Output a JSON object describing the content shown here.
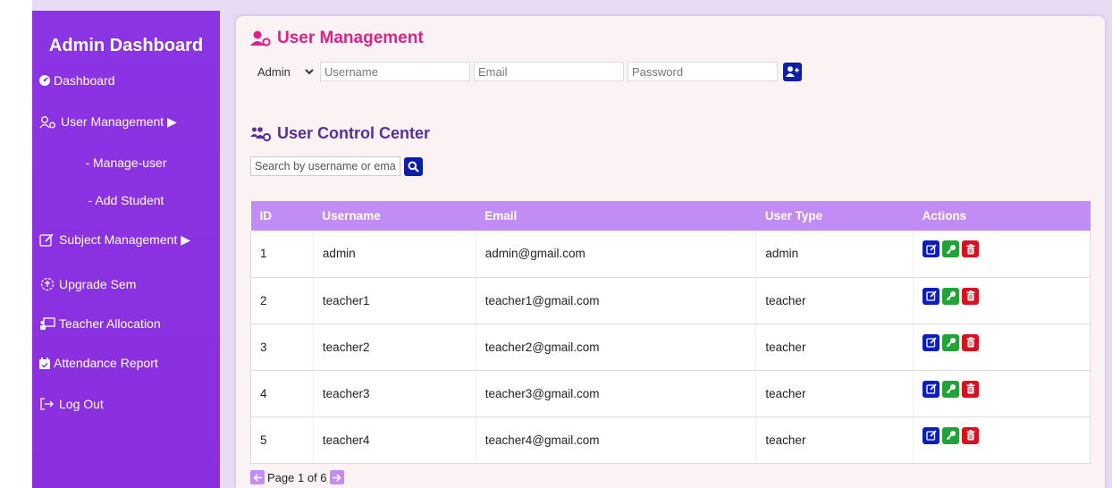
{
  "sidebar": {
    "title": "Admin Dashboard",
    "items": [
      {
        "label": "Dashboard",
        "icon": "dashboard-icon"
      },
      {
        "label": "User Management ▶",
        "icon": "user-gear-icon"
      },
      {
        "label": "- Manage-user"
      },
      {
        "label": "- Add Student"
      },
      {
        "label": "Subject Management ▶",
        "icon": "edit-icon"
      },
      {
        "label": "Upgrade Sem",
        "icon": "upload-icon"
      },
      {
        "label": "Teacher Allocation",
        "icon": "chalkboard-teacher-icon"
      },
      {
        "label": "Attendance Report",
        "icon": "calendar-check-icon"
      },
      {
        "label": "Log Out",
        "icon": "logout-icon"
      }
    ]
  },
  "user_management": {
    "title": "User Management",
    "role_selected": "Admin",
    "role_options": [
      "Admin"
    ],
    "username_placeholder": "Username",
    "email_placeholder": "Email",
    "password_placeholder": "Password"
  },
  "control_center": {
    "title": "User Control Center",
    "search_placeholder": "Search by username or email"
  },
  "table": {
    "headers": [
      "ID",
      "Username",
      "Email",
      "User Type",
      "Actions"
    ],
    "rows": [
      {
        "id": "1",
        "username": "admin",
        "email": "admin@gmail.com",
        "type": "admin"
      },
      {
        "id": "2",
        "username": "teacher1",
        "email": "teacher1@gmail.com",
        "type": "teacher"
      },
      {
        "id": "3",
        "username": "teacher2",
        "email": "teacher2@gmail.com",
        "type": "teacher"
      },
      {
        "id": "4",
        "username": "teacher3",
        "email": "teacher3@gmail.com",
        "type": "teacher"
      },
      {
        "id": "5",
        "username": "teacher4",
        "email": "teacher4@gmail.com",
        "type": "teacher"
      }
    ]
  },
  "pagination": {
    "label": "Page 1 of 6"
  },
  "colors": {
    "sidebar_bg": "#8a2be2",
    "title_pink": "#e0218a",
    "title_purple": "#5a2f9a",
    "table_header": "#c28cf5",
    "button_blue": "#0b1fa8",
    "edit_blue": "#0b1fbf",
    "key_green": "#21a33a",
    "delete_red": "#d91020"
  }
}
